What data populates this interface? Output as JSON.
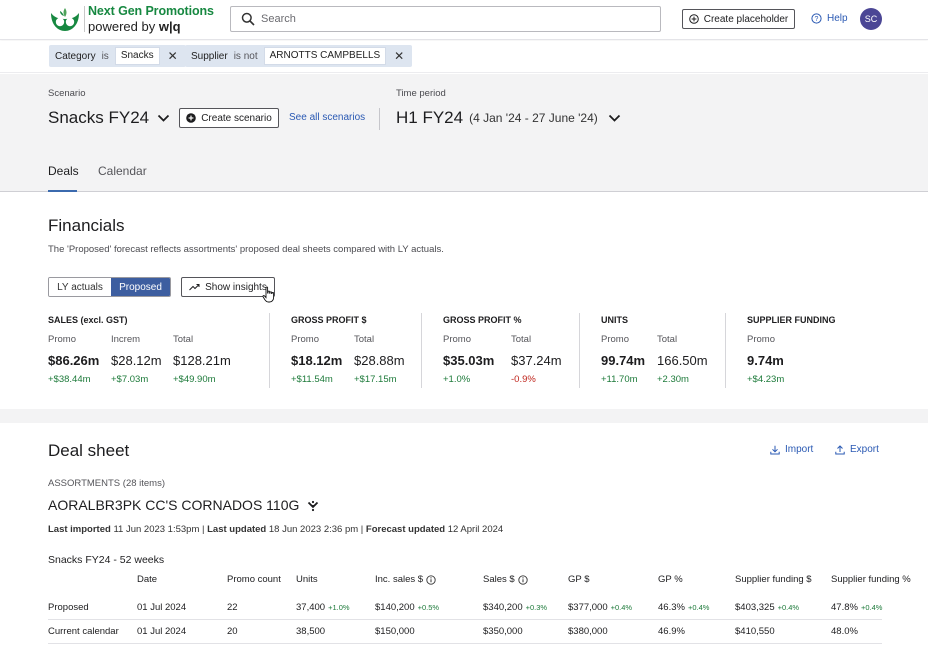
{
  "header": {
    "brand_title": "Next Gen Promotions",
    "brand_sub_prefix": "powered by",
    "brand_sub_name": "w|q",
    "search_placeholder": "Search",
    "create_placeholder_label": "Create placeholder",
    "help_label": "Help",
    "avatar_initials": "SC"
  },
  "filters": [
    {
      "key": "Category",
      "op": "is",
      "value": "Snacks"
    },
    {
      "key": "Supplier",
      "op": "is not",
      "value": "ARNOTTS CAMPBELLS"
    }
  ],
  "scenario": {
    "label": "Scenario",
    "name": "Snacks FY24",
    "create_label": "Create scenario",
    "see_all_label": "See all scenarios"
  },
  "time_period": {
    "label": "Time period",
    "name": "H1 FY24",
    "range": "(4 Jan '24 - 27 June '24)"
  },
  "tabs": [
    {
      "label": "Deals",
      "active": true
    },
    {
      "label": "Calendar",
      "active": false
    }
  ],
  "financials": {
    "title": "Financials",
    "description": "The 'Proposed' forecast reflects assortments' proposed deal sheets compared with LY actuals.",
    "toggle": [
      "LY actuals",
      "Proposed"
    ],
    "insights_label": "Show insights",
    "groups": [
      {
        "title": "SALES (excl. GST)",
        "cols": [
          {
            "label": "Promo",
            "value": "$86.26m",
            "delta": "+$38.44m",
            "bold": true,
            "neg": false
          },
          {
            "label": "Increm",
            "value": "$28.12m",
            "delta": "+$7.03m",
            "bold": false,
            "neg": false
          },
          {
            "label": "Total",
            "value": "$128.21m",
            "delta": "+$49.90m",
            "bold": false,
            "neg": false
          }
        ]
      },
      {
        "title": "GROSS PROFIT $",
        "cols": [
          {
            "label": "Promo",
            "value": "$18.12m",
            "delta": "+$11.54m",
            "bold": true,
            "neg": false
          },
          {
            "label": "Total",
            "value": "$28.88m",
            "delta": "+$17.15m",
            "bold": false,
            "neg": false
          }
        ]
      },
      {
        "title": "GROSS PROFIT %",
        "cols": [
          {
            "label": "Promo",
            "value": "$35.03m",
            "delta": "+1.0%",
            "bold": true,
            "neg": false
          },
          {
            "label": "Total",
            "value": "$37.24m",
            "delta": "-0.9%",
            "bold": false,
            "neg": true
          }
        ]
      },
      {
        "title": "UNITS",
        "cols": [
          {
            "label": "Promo",
            "value": "99.74m",
            "delta": "+11.70m",
            "bold": true,
            "neg": false
          },
          {
            "label": "Total",
            "value": "166.50m",
            "delta": "+2.30m",
            "bold": false,
            "neg": false
          }
        ]
      },
      {
        "title": "SUPPLIER FUNDING",
        "cols": [
          {
            "label": "Promo",
            "value": "9.74m",
            "delta": "+$4.23m",
            "bold": true,
            "neg": false
          }
        ]
      }
    ]
  },
  "deal_sheet": {
    "title": "Deal sheet",
    "import_label": "Import",
    "export_label": "Export",
    "assortments_label": "ASSORTMENTS (28 items)",
    "assortment_name": "AORALBR3PK CC'S CORNADOS 110G",
    "meta": {
      "last_imported_label": "Last imported",
      "last_imported": "11 Jun 2023 1:53pm",
      "last_updated_label": "Last updated",
      "last_updated": "18 Jun 2023 2:36 pm",
      "forecast_updated_label": "Forecast updated",
      "forecast_updated": "12 April 2024"
    },
    "subtitle": "Snacks FY24 - 52 weeks",
    "columns": [
      "Date",
      "Promo count",
      "Units",
      "Inc. sales $",
      "Sales $",
      "GP $",
      "GP %",
      "Supplier funding $",
      "Supplier funding %"
    ],
    "rows": [
      {
        "label": "Proposed",
        "cells": [
          {
            "v": "01 Jul 2024",
            "d": ""
          },
          {
            "v": "22",
            "d": ""
          },
          {
            "v": "37,400",
            "d": "+1.0%"
          },
          {
            "v": "$140,200",
            "d": "+0.5%"
          },
          {
            "v": "$340,200",
            "d": "+0.3%"
          },
          {
            "v": "$377,000",
            "d": "+0.4%"
          },
          {
            "v": "46.3%",
            "d": "+0.4%"
          },
          {
            "v": "$403,325",
            "d": "+0.4%"
          },
          {
            "v": "47.8%",
            "d": "+0.4%"
          }
        ]
      },
      {
        "label": "Current calendar",
        "cells": [
          {
            "v": "01 Jul 2024",
            "d": ""
          },
          {
            "v": "20",
            "d": ""
          },
          {
            "v": "38,500",
            "d": ""
          },
          {
            "v": "$150,000",
            "d": ""
          },
          {
            "v": "$350,000",
            "d": ""
          },
          {
            "v": "$380,000",
            "d": ""
          },
          {
            "v": "46.9%",
            "d": ""
          },
          {
            "v": "$410,550",
            "d": ""
          },
          {
            "v": "48.0%",
            "d": ""
          }
        ]
      }
    ]
  },
  "colors": {
    "brand_green": "#178841",
    "link_blue": "#2a59b3",
    "toggle_active": "#3d5ea0",
    "positive": "#1d7a3a",
    "negative": "#c0271f",
    "avatar": "#4b4695"
  }
}
